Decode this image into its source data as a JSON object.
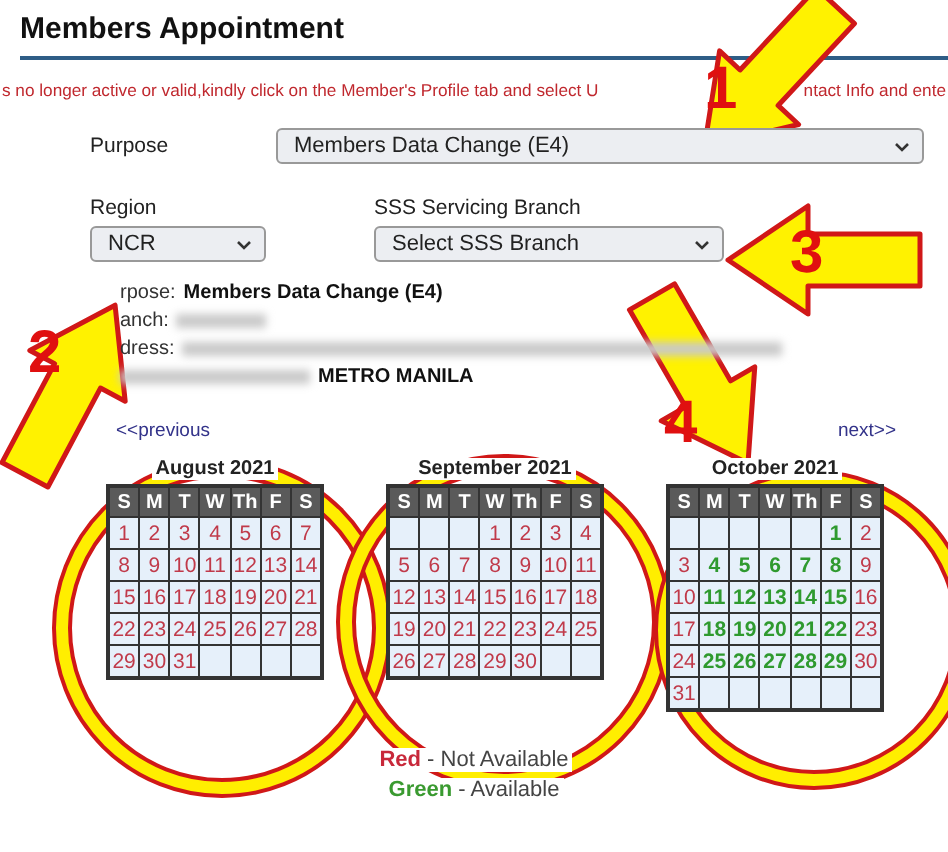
{
  "page": {
    "title": "Members Appointment"
  },
  "notice": {
    "parts": [
      "s no longer active or valid,kindly click on the Member's Profile tab and select U",
      "ntact Info and ente"
    ]
  },
  "form": {
    "purpose": {
      "label": "Purpose",
      "value": "Members Data Change (E4)"
    },
    "region": {
      "label": "Region",
      "value": "NCR"
    },
    "branch": {
      "label": "SSS Servicing Branch",
      "value": "Select SSS Branch"
    }
  },
  "summary": [
    {
      "label": "rpose:",
      "value": "Members Data Change (E4)",
      "redacted": false
    },
    {
      "label": "anch:",
      "redacted": true
    },
    {
      "label": "dress:",
      "redacted": true
    },
    {
      "value": "METRO MANILA",
      "redacted": true
    }
  ],
  "nav": {
    "previous": "<<previous",
    "next": "next>>"
  },
  "months": [
    {
      "title": "August 2021",
      "weekdays": [
        "S",
        "M",
        "T",
        "W",
        "Th",
        "F",
        "S"
      ],
      "cells": [
        {
          "kind": "day",
          "day": "1",
          "available": false
        },
        {
          "kind": "day",
          "day": "2",
          "available": false
        },
        {
          "kind": "day",
          "day": "3",
          "available": false
        },
        {
          "kind": "day",
          "day": "4",
          "available": false
        },
        {
          "kind": "day",
          "day": "5",
          "available": false
        },
        {
          "kind": "day",
          "day": "6",
          "available": false
        },
        {
          "kind": "day",
          "day": "7",
          "available": false
        },
        {
          "kind": "day",
          "day": "8",
          "available": false
        },
        {
          "kind": "day",
          "day": "9",
          "available": false
        },
        {
          "kind": "day",
          "day": "10",
          "available": false
        },
        {
          "kind": "day",
          "day": "11",
          "available": false
        },
        {
          "kind": "day",
          "day": "12",
          "available": false
        },
        {
          "kind": "day",
          "day": "13",
          "available": false
        },
        {
          "kind": "day",
          "day": "14",
          "available": false
        },
        {
          "kind": "day",
          "day": "15",
          "available": false
        },
        {
          "kind": "day",
          "day": "16",
          "available": false
        },
        {
          "kind": "day",
          "day": "17",
          "available": false
        },
        {
          "kind": "day",
          "day": "18",
          "available": false
        },
        {
          "kind": "day",
          "day": "19",
          "available": false
        },
        {
          "kind": "day",
          "day": "20",
          "available": false
        },
        {
          "kind": "day",
          "day": "21",
          "available": false
        },
        {
          "kind": "day",
          "day": "22",
          "available": false
        },
        {
          "kind": "day",
          "day": "23",
          "available": false
        },
        {
          "kind": "day",
          "day": "24",
          "available": false
        },
        {
          "kind": "day",
          "day": "25",
          "available": false
        },
        {
          "kind": "day",
          "day": "26",
          "available": false
        },
        {
          "kind": "day",
          "day": "27",
          "available": false
        },
        {
          "kind": "day",
          "day": "28",
          "available": false
        },
        {
          "kind": "day",
          "day": "29",
          "available": false
        },
        {
          "kind": "day",
          "day": "30",
          "available": false
        },
        {
          "kind": "day",
          "day": "31",
          "available": false
        },
        {
          "kind": "blank"
        },
        {
          "kind": "blank"
        },
        {
          "kind": "blank"
        },
        {
          "kind": "blank"
        }
      ]
    },
    {
      "title": "September 2021",
      "weekdays": [
        "S",
        "M",
        "T",
        "W",
        "Th",
        "F",
        "S"
      ],
      "cells": [
        {
          "kind": "blank"
        },
        {
          "kind": "blank"
        },
        {
          "kind": "blank"
        },
        {
          "kind": "day",
          "day": "1",
          "available": false
        },
        {
          "kind": "day",
          "day": "2",
          "available": false
        },
        {
          "kind": "day",
          "day": "3",
          "available": false
        },
        {
          "kind": "day",
          "day": "4",
          "available": false
        },
        {
          "kind": "day",
          "day": "5",
          "available": false
        },
        {
          "kind": "day",
          "day": "6",
          "available": false
        },
        {
          "kind": "day",
          "day": "7",
          "available": false
        },
        {
          "kind": "day",
          "day": "8",
          "available": false
        },
        {
          "kind": "day",
          "day": "9",
          "available": false
        },
        {
          "kind": "day",
          "day": "10",
          "available": false
        },
        {
          "kind": "day",
          "day": "11",
          "available": false
        },
        {
          "kind": "day",
          "day": "12",
          "available": false
        },
        {
          "kind": "day",
          "day": "13",
          "available": false
        },
        {
          "kind": "day",
          "day": "14",
          "available": false
        },
        {
          "kind": "day",
          "day": "15",
          "available": false
        },
        {
          "kind": "day",
          "day": "16",
          "available": false
        },
        {
          "kind": "day",
          "day": "17",
          "available": false
        },
        {
          "kind": "day",
          "day": "18",
          "available": false
        },
        {
          "kind": "day",
          "day": "19",
          "available": false
        },
        {
          "kind": "day",
          "day": "20",
          "available": false
        },
        {
          "kind": "day",
          "day": "21",
          "available": false
        },
        {
          "kind": "day",
          "day": "22",
          "available": false
        },
        {
          "kind": "day",
          "day": "23",
          "available": false
        },
        {
          "kind": "day",
          "day": "24",
          "available": false
        },
        {
          "kind": "day",
          "day": "25",
          "available": false
        },
        {
          "kind": "day",
          "day": "26",
          "available": false
        },
        {
          "kind": "day",
          "day": "27",
          "available": false
        },
        {
          "kind": "day",
          "day": "28",
          "available": false
        },
        {
          "kind": "day",
          "day": "29",
          "available": false
        },
        {
          "kind": "day",
          "day": "30",
          "available": false
        },
        {
          "kind": "blank"
        },
        {
          "kind": "blank"
        }
      ]
    },
    {
      "title": "October 2021",
      "weekdays": [
        "S",
        "M",
        "T",
        "W",
        "Th",
        "F",
        "S"
      ],
      "cells": [
        {
          "kind": "blank"
        },
        {
          "kind": "blank"
        },
        {
          "kind": "blank"
        },
        {
          "kind": "blank"
        },
        {
          "kind": "blank"
        },
        {
          "kind": "day",
          "day": "1",
          "available": true
        },
        {
          "kind": "day",
          "day": "2",
          "available": false
        },
        {
          "kind": "day",
          "day": "3",
          "available": false
        },
        {
          "kind": "day",
          "day": "4",
          "available": true
        },
        {
          "kind": "day",
          "day": "5",
          "available": true
        },
        {
          "kind": "day",
          "day": "6",
          "available": true
        },
        {
          "kind": "day",
          "day": "7",
          "available": true
        },
        {
          "kind": "day",
          "day": "8",
          "available": true
        },
        {
          "kind": "day",
          "day": "9",
          "available": false
        },
        {
          "kind": "day",
          "day": "10",
          "available": false
        },
        {
          "kind": "day",
          "day": "11",
          "available": true
        },
        {
          "kind": "day",
          "day": "12",
          "available": true
        },
        {
          "kind": "day",
          "day": "13",
          "available": true
        },
        {
          "kind": "day",
          "day": "14",
          "available": true
        },
        {
          "kind": "day",
          "day": "15",
          "available": true
        },
        {
          "kind": "day",
          "day": "16",
          "available": false
        },
        {
          "kind": "day",
          "day": "17",
          "available": false
        },
        {
          "kind": "day",
          "day": "18",
          "available": true
        },
        {
          "kind": "day",
          "day": "19",
          "available": true
        },
        {
          "kind": "day",
          "day": "20",
          "available": true
        },
        {
          "kind": "day",
          "day": "21",
          "available": true
        },
        {
          "kind": "day",
          "day": "22",
          "available": true
        },
        {
          "kind": "day",
          "day": "23",
          "available": false
        },
        {
          "kind": "day",
          "day": "24",
          "available": false
        },
        {
          "kind": "day",
          "day": "25",
          "available": true
        },
        {
          "kind": "day",
          "day": "26",
          "available": true
        },
        {
          "kind": "day",
          "day": "27",
          "available": true
        },
        {
          "kind": "day",
          "day": "28",
          "available": true
        },
        {
          "kind": "day",
          "day": "29",
          "available": true
        },
        {
          "kind": "day",
          "day": "30",
          "available": false
        },
        {
          "kind": "day",
          "day": "31",
          "available": false
        },
        {
          "kind": "blank"
        },
        {
          "kind": "blank"
        },
        {
          "kind": "blank"
        },
        {
          "kind": "blank"
        },
        {
          "kind": "blank"
        },
        {
          "kind": "blank"
        }
      ]
    }
  ],
  "legend": [
    {
      "word": "Red",
      "text": "- Not Available",
      "kind": "unavailable"
    },
    {
      "word": "Green",
      "text": "- Available",
      "kind": "available"
    }
  ],
  "annotations": [
    {
      "label": "1"
    },
    {
      "label": "2"
    },
    {
      "label": "3"
    },
    {
      "label": "4"
    }
  ]
}
